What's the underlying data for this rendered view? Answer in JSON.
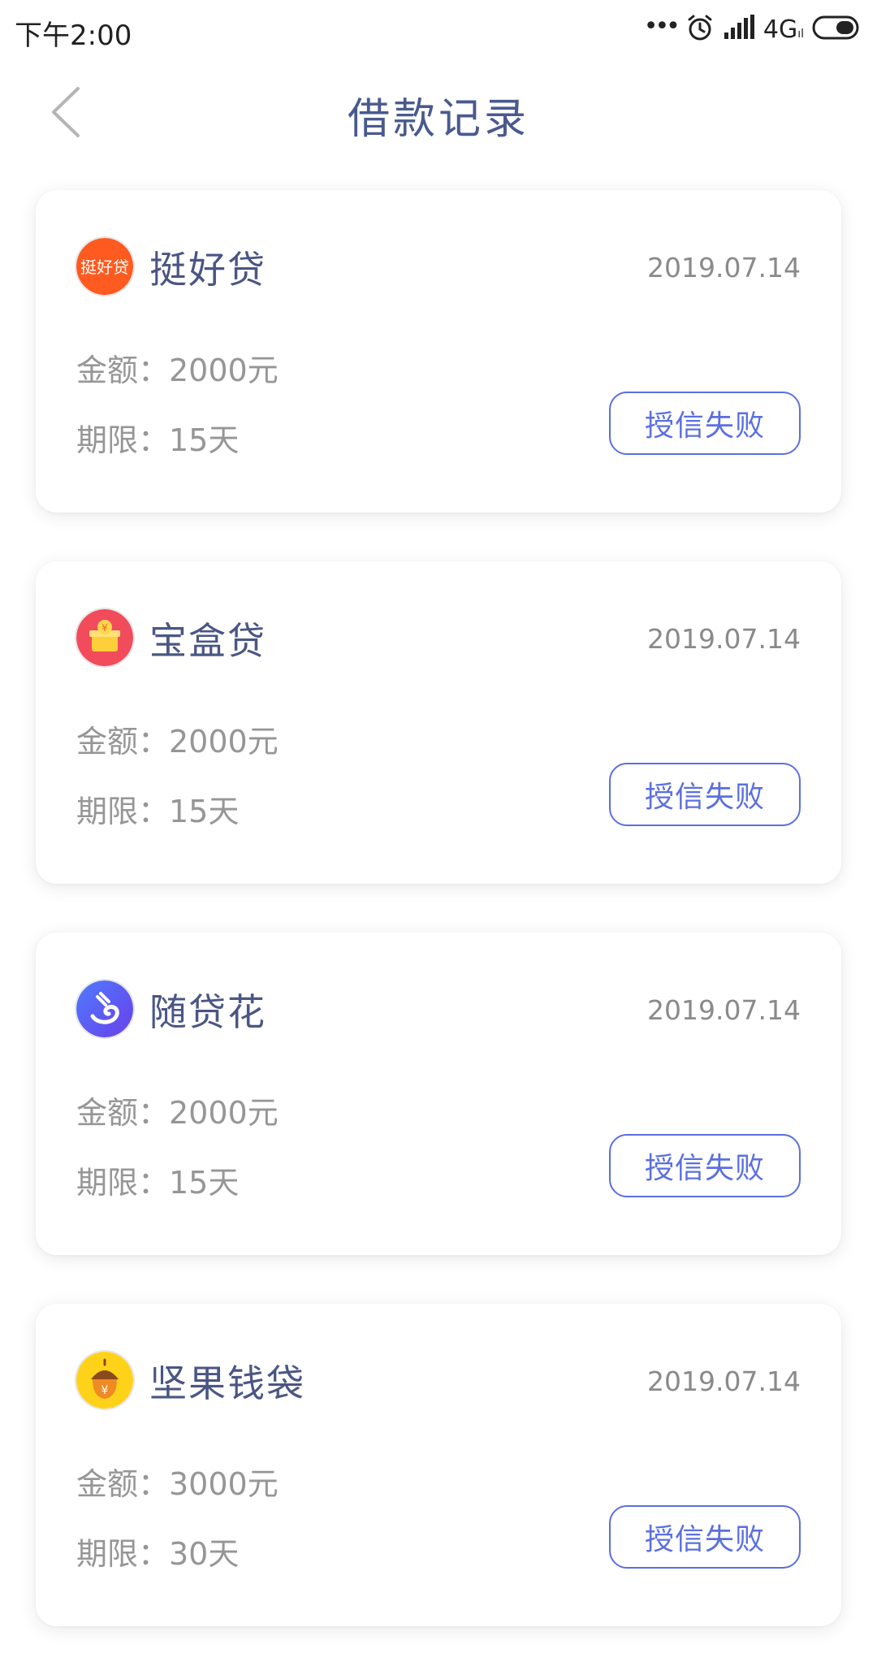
{
  "status_bar": {
    "time": "下午2:00",
    "dots": "•••",
    "network": "4G",
    "network_sub": "ıl"
  },
  "header": {
    "title": "借款记录"
  },
  "loans": [
    {
      "name": "挺好贷",
      "logo_text": "挺好贷",
      "date": "2019.07.14",
      "amount": "金额：2000元",
      "term": "期限：15天",
      "status": "授信失败"
    },
    {
      "name": "宝盒贷",
      "logo_text": "¥",
      "date": "2019.07.14",
      "amount": "金额：2000元",
      "term": "期限：15天",
      "status": "授信失败"
    },
    {
      "name": "随贷花",
      "logo_text": "",
      "date": "2019.07.14",
      "amount": "金额：2000元",
      "term": "期限：15天",
      "status": "授信失败"
    },
    {
      "name": "坚果钱袋",
      "logo_text": "¥",
      "date": "2019.07.14",
      "amount": "金额：3000元",
      "term": "期限：30天",
      "status": "授信失败"
    }
  ],
  "colors": {
    "title": "#4a5a8f",
    "accent": "#5b6fe0",
    "logo_tinghao": "#ff5a1f",
    "logo_baohe": "#f24b5b",
    "logo_suidai": "#5566ee",
    "logo_jianguo": "#ffd21a"
  }
}
